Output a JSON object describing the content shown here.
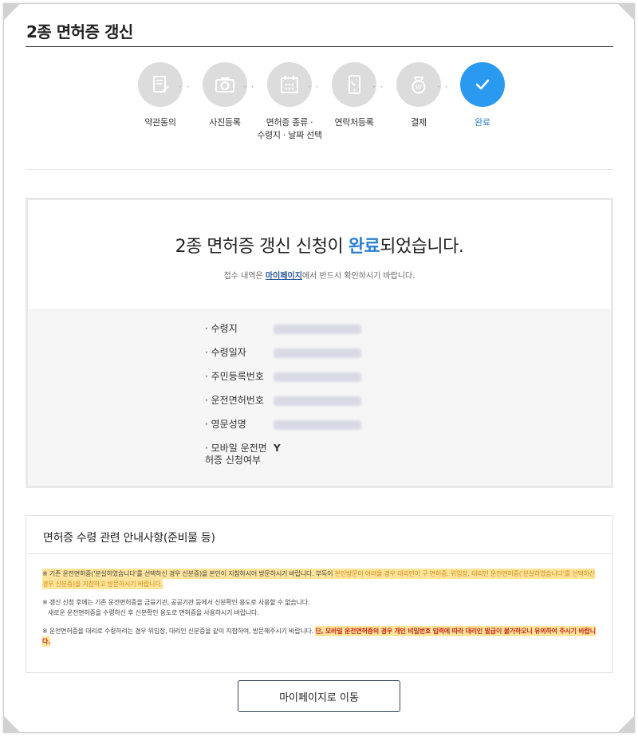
{
  "page": {
    "title": "2종 면허증 갱신"
  },
  "steps": [
    {
      "label": "약관동의",
      "icon": "document-pen-icon"
    },
    {
      "label": "사진등록",
      "icon": "camera-icon"
    },
    {
      "label_line1": "면허증 종류 ·",
      "label_line2": "수령지 · 날짜 선택",
      "icon": "calendar-icon"
    },
    {
      "label": "연락처등록",
      "icon": "phone-icon"
    },
    {
      "label": "결제",
      "icon": "payment-icon"
    },
    {
      "label": "완료",
      "icon": "check-icon",
      "active": true
    }
  ],
  "result": {
    "title_pre": "2종 면허증 갱신 신청이 ",
    "title_highlight": "완료",
    "title_post": "되었습니다.",
    "sub_pre": "접수 내역은 ",
    "sub_link": "마이페이지",
    "sub_post": "에서 반드시 확인하시기 바랍니다.",
    "fields": [
      {
        "key": "· 수령지"
      },
      {
        "key": "· 수령일자"
      },
      {
        "key": "· 주민등록번호"
      },
      {
        "key": "· 운전면허번호"
      },
      {
        "key": "· 영문성명"
      }
    ],
    "mobile_key_line1": "· 모바일 운전면",
    "mobile_key_line2": "허증 신청여부",
    "mobile_value": "Y"
  },
  "notice": {
    "title": "면허증 수령 관련 안내사항(준비물 등)",
    "note1_a": "※ 기존 운전면허증('분실하였습니다'를 선택하신 경우 신분증)을 본인이 지참하시어 방문하시기 바랍니다. 부득이 ",
    "note1_b": "본인방문이 어려울 경우 대리인이 구 면허증, 위임장, 대리인 운전면허증('분실하였습니다'를 선택하신 경우 신분증)을 지참하고 방문하시기 바랍니다.",
    "note2_line1": "※ 갱신 신청 후에는 기존 운전면허증을 금융기관, 공공기관 등에서 신분확인 용도로 사용할 수 없습니다.",
    "note2_line2": "새로운 운전면허증을 수령하신 후 신분확인 용도로 면허증을 사용하시기 바랍니다.",
    "note3_a": "※ 운전면허증을 대리로 수령하려는 경우 위임장, 대리인 신분증을 같이 지참하여, 방문해주시기 바랍니다. ",
    "note3_b": "단, 모바일 운전면허증의 경우 개인 비밀번호 입력에 따라 대리인 발급이 불가하오니 유의하여 주시기 바랍니다."
  },
  "buttons": {
    "goto_mypage": "마이페이지로 이동"
  },
  "colors": {
    "accent": "#2a9af0",
    "highlight": "#ffd666",
    "warning": "#c8281f"
  }
}
